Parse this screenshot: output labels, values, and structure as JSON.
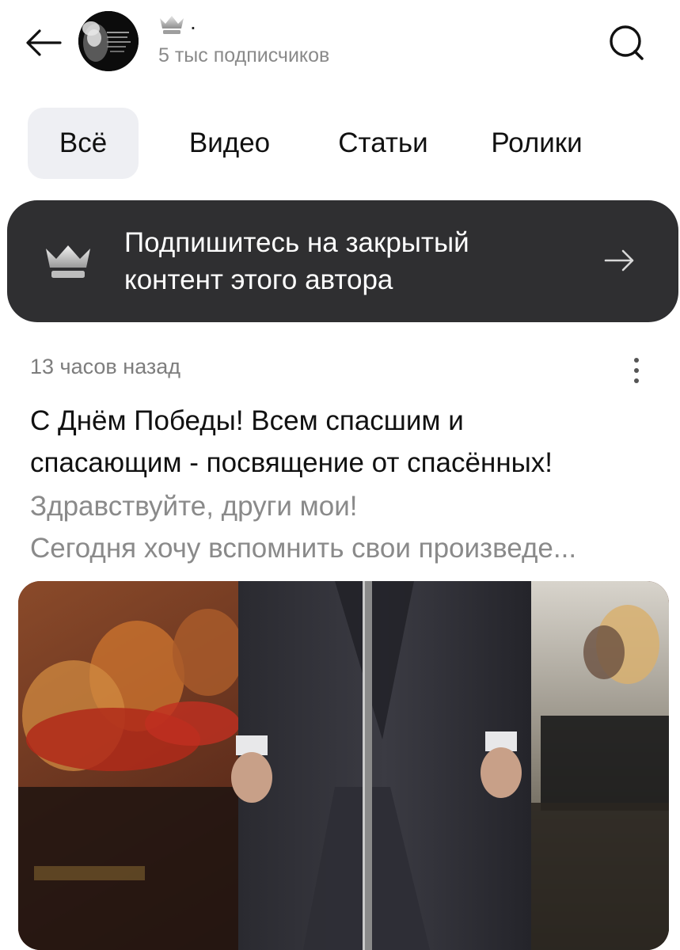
{
  "header": {
    "channel_dot": ".",
    "subscribers": "5 тыс подписчиков"
  },
  "tabs": [
    {
      "label": "Всё",
      "active": true
    },
    {
      "label": "Видео",
      "active": false
    },
    {
      "label": "Статьи",
      "active": false
    },
    {
      "label": "Ролики",
      "active": false
    }
  ],
  "banner": {
    "line1": "Подпишитесь на закрытый",
    "line2": "контент этого автора"
  },
  "post": {
    "time": "13 часов назад",
    "title_line1": "С Днём Победы! Всем спасшим и",
    "title_line2": "спасающим - посвящение от спасённых!",
    "excerpt_line1": "Здравствуйте, други мои!",
    "excerpt_line2": "Сегодня хочу вспомнить свои произведе..."
  },
  "colors": {
    "banner_bg": "#2f2f31",
    "tab_active_bg": "#eeeff3",
    "muted_text": "#8a8a8a"
  },
  "icons": {
    "back": "arrow-left-icon",
    "search": "search-icon",
    "crown": "crown-icon",
    "banner_arrow": "arrow-right-icon",
    "post_menu": "more-vertical-icon"
  }
}
